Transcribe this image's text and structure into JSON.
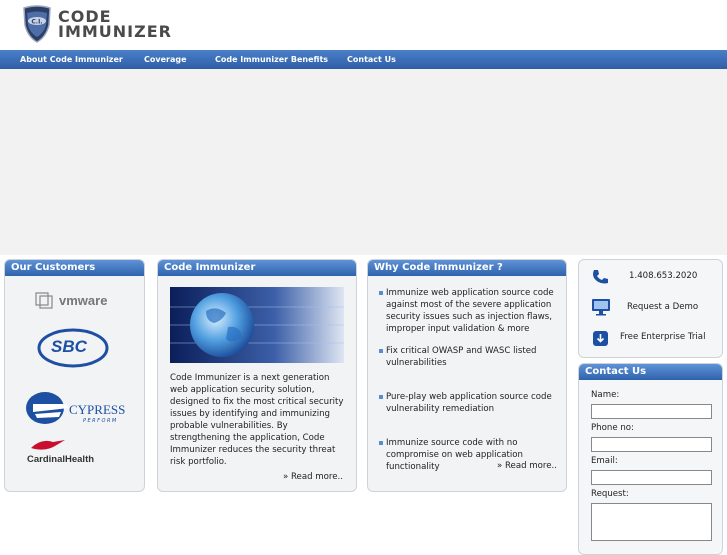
{
  "header": {
    "logo_line1": "CODE",
    "logo_line2": "IMMUNIZER",
    "logo_badge": "C.I."
  },
  "nav": {
    "items": [
      "About Code Immunizer",
      "Coverage",
      "Code Immunizer Benefits",
      "Contact Us"
    ]
  },
  "customers": {
    "title": "Our Customers",
    "logos": [
      "vmware",
      "SBC",
      "CYPRESS",
      "PERFORM",
      "CardinalHealth"
    ]
  },
  "about": {
    "title": "Code Immunizer",
    "body": "Code Immunizer is a next generation web application security solution, designed to fix the most critical security issues by identifying and immunizing probable vulnerabilities. By strengthening the application, Code Immunizer reduces the security threat risk portfolio.",
    "read_more": "» Read more.."
  },
  "why": {
    "title": "Why Code Immunizer ?",
    "points": [
      "Immunize web application source code against most of the severe application security issues such as injection flaws, improper input validation & more",
      "Fix critical OWASP and WASC listed vulnerabilities",
      "Pure-play web application source code vulnerability remediation",
      "Immunize source code with no compromise on web application functionality"
    ],
    "read_more": "» Read more.."
  },
  "quick": {
    "phone": "1.408.653.2020",
    "demo": "Request a Demo",
    "trial": "Free Enterprise Trial"
  },
  "contact": {
    "title": "Contact Us",
    "name_label": "Name:",
    "phone_label": "Phone no:",
    "email_label": "Email:",
    "request_label": "Request:"
  },
  "colors": {
    "nav_blue": "#2f5ea6",
    "panel_head": "#3a6fb8"
  }
}
